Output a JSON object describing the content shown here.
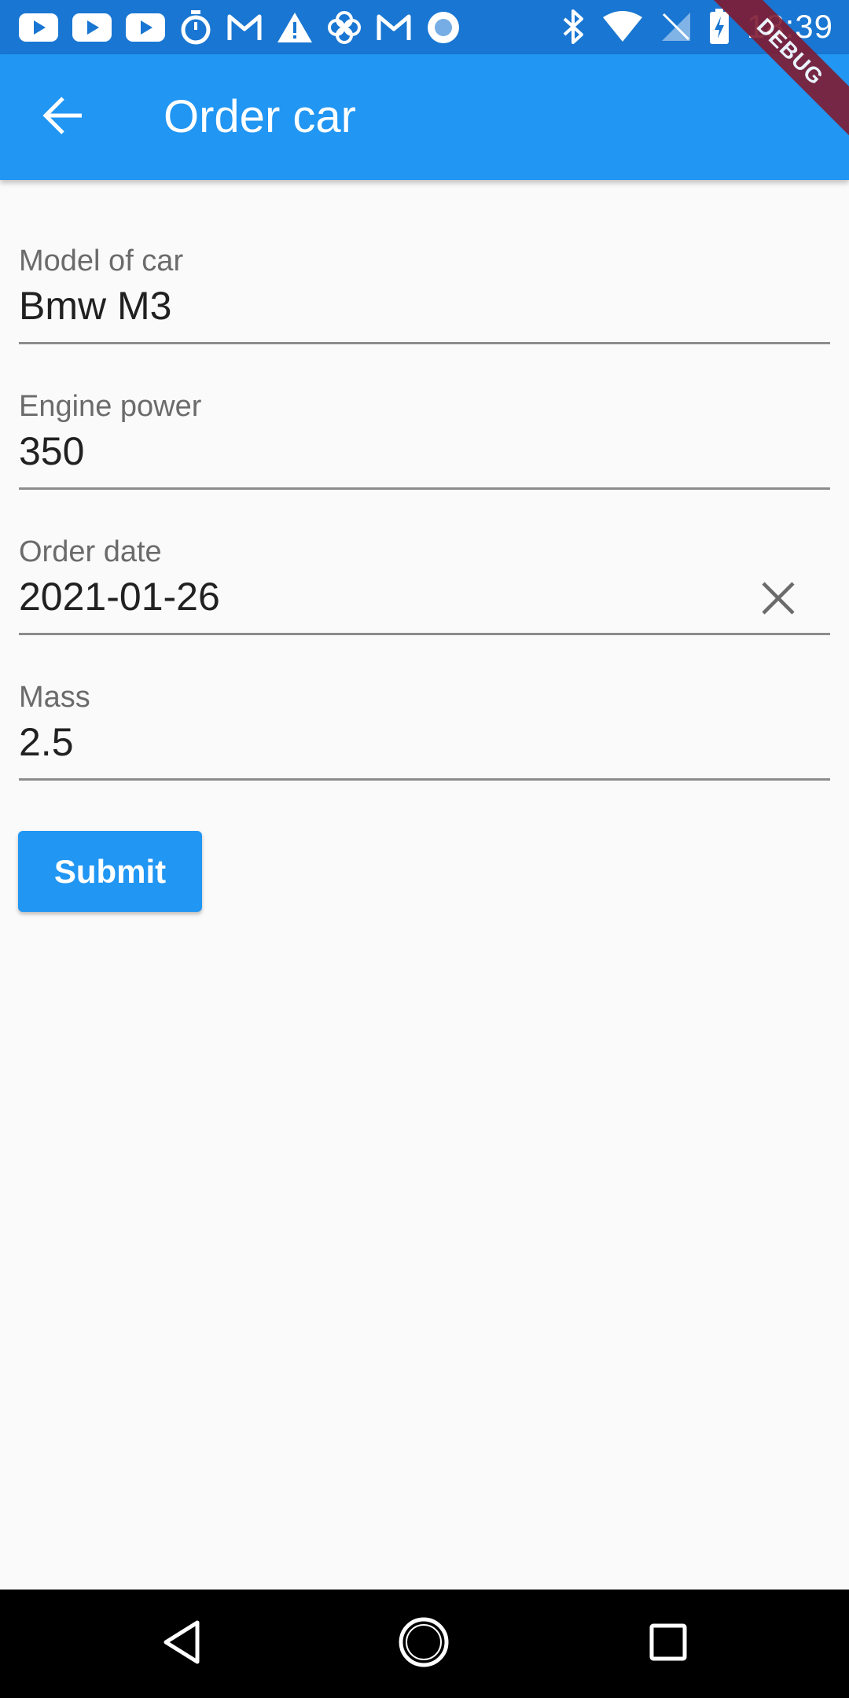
{
  "status_bar": {
    "time": "18:39",
    "left_icons": [
      "youtube-icon",
      "youtube-icon",
      "youtube-icon",
      "stopwatch-icon",
      "gmail-icon",
      "warning-icon",
      "pinwheel-icon",
      "gmail-icon",
      "record-icon"
    ],
    "right_icons": [
      "bluetooth-icon",
      "wifi-icon",
      "no-signal-icon",
      "battery-icon"
    ]
  },
  "app_bar": {
    "title": "Order car",
    "back_icon": "arrow-back-icon"
  },
  "debug_banner": "DEBUG",
  "form": {
    "fields": [
      {
        "label": "Model of car",
        "value": "Bmw M3"
      },
      {
        "label": "Engine power",
        "value": "350"
      },
      {
        "label": "Order date",
        "value": "2021-01-26",
        "clear_icon": "close-icon"
      },
      {
        "label": "Mass",
        "value": "2.5"
      }
    ],
    "submit_label": "Submit"
  },
  "nav_bar": {
    "buttons": [
      "back-triangle-icon",
      "home-circle-icon",
      "recents-square-icon"
    ]
  },
  "colors": {
    "status_bar": "#1976d2",
    "app_bar": "#2196f3",
    "accent": "#2196f3",
    "background": "#fafafa",
    "debug_ribbon": "#7f1b32"
  }
}
